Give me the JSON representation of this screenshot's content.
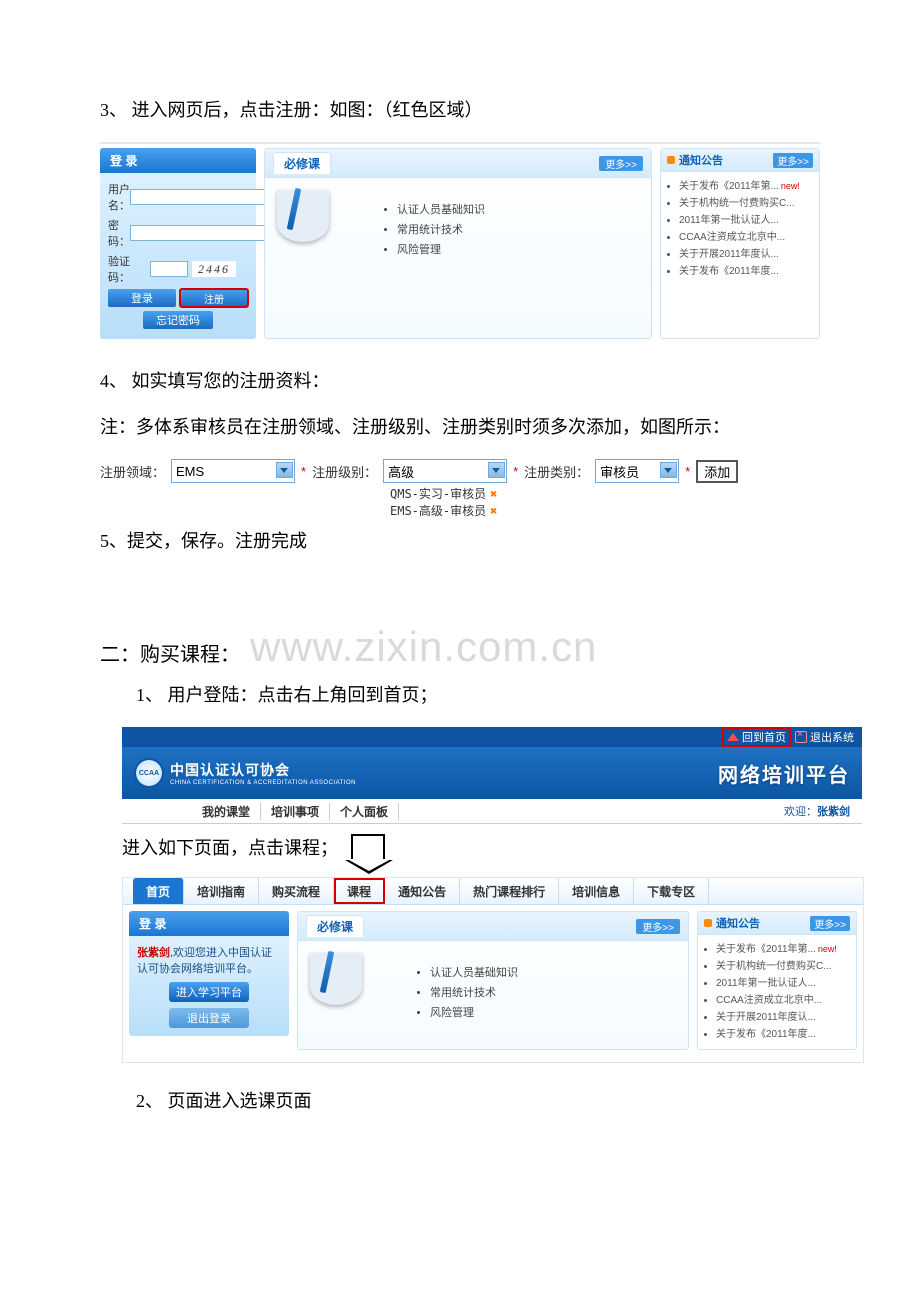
{
  "step3": "3、  进入网页后，点击注册：如图：（红色区域）",
  "shot1": {
    "login": {
      "title": "登 录",
      "userLabel": "用户名：",
      "pwdLabel": "密  码：",
      "capLabel": "验证码：",
      "captcha": "2446",
      "loginBtn": "登录",
      "registerBtn": "注册",
      "forgotBtn": "忘记密码"
    },
    "course": {
      "tab": "必修课",
      "more": "更多>>",
      "items": [
        "认证人员基础知识",
        "常用统计技术",
        "风险管理"
      ]
    },
    "notice": {
      "title": "通知公告",
      "more": "更多>>",
      "items": [
        {
          "t": "关于发布《2011年第...",
          "new": true
        },
        {
          "t": "关于机构统一付费购买C..."
        },
        {
          "t": "2011年第一批认证人..."
        },
        {
          "t": "CCAA注资成立北京中..."
        },
        {
          "t": "关于开展2011年度认..."
        },
        {
          "t": "关于发布《2011年度..."
        }
      ]
    }
  },
  "step4": "4、  如实填写您的注册资料：",
  "note": "注：多体系审核员在注册领域、注册级别、注册类别时须多次添加，如图所示：",
  "reg": {
    "fieldLabel": "注册领域：",
    "fieldValue": "EMS",
    "levelLabel": "注册级别：",
    "levelValue": "高级",
    "catLabel": "注册类别：",
    "catValue": "审核员",
    "addBtn": "添加",
    "added": [
      "QMS-实习-审核员",
      "EMS-高级-审核员"
    ]
  },
  "step5": "5、提交，保存。注册完成",
  "section2": "二：购买课程：",
  "watermark": "www.zixin.com.cn",
  "step2_1": "1、  用户登陆：点击右上角回到首页；",
  "banner": {
    "home": "回到首页",
    "exit": "退出系统",
    "logoAbbr": "CCAA",
    "orgCn": "中国认证认可协会",
    "orgEn": "CHINA CERTIFICATION & ACCREDITATION ASSOCIATION",
    "right": "网络培训平台",
    "menu": [
      "我的课堂",
      "培训事项",
      "个人面板"
    ],
    "welcome": "欢迎：",
    "user": "张紫剑"
  },
  "step2_1b": "进入如下页面，点击课程；",
  "nav": {
    "tabs": [
      "首页",
      "培训指南",
      "购买流程",
      "课程",
      "通知公告",
      "热门课程排行",
      "培训信息",
      "下载专区"
    ]
  },
  "shot4login": {
    "title": "登 录",
    "msg1a": "张紫剑",
    "msg1b": ",欢迎您进入中国认证认可协会网络培训平台。",
    "btn1": "进入学习平台",
    "btn2": "退出登录"
  },
  "step2_2": "2、   页面进入选课页面"
}
